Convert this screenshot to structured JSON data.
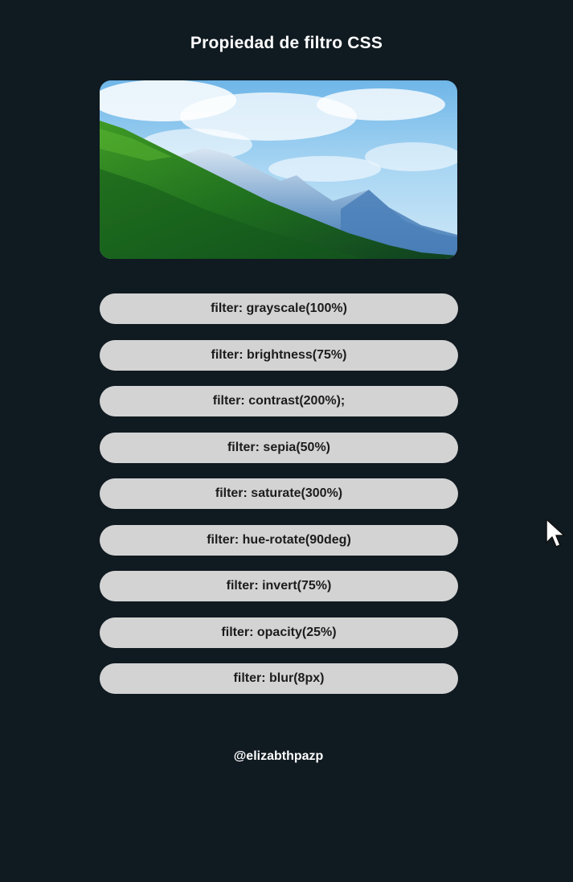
{
  "page": {
    "title": "Propiedad de filtro CSS",
    "footer_handle": "@elizabthpazp"
  },
  "image": {
    "subject": "mountain-landscape"
  },
  "filters": [
    {
      "label": "filter: grayscale(100%)"
    },
    {
      "label": "filter: brightness(75%)"
    },
    {
      "label": "filter: contrast(200%);"
    },
    {
      "label": "filter: sepia(50%)"
    },
    {
      "label": "filter: saturate(300%)"
    },
    {
      "label": "filter: hue-rotate(90deg)"
    },
    {
      "label": "filter: invert(75%)"
    },
    {
      "label": "filter: opacity(25%)"
    },
    {
      "label": "filter: blur(8px)"
    }
  ],
  "colors": {
    "background": "#101a21",
    "button_bg": "#d3d3d3",
    "button_text": "#1c1c1c",
    "text": "#ffffff"
  },
  "icons": {
    "cursor": "mouse-pointer-icon"
  }
}
